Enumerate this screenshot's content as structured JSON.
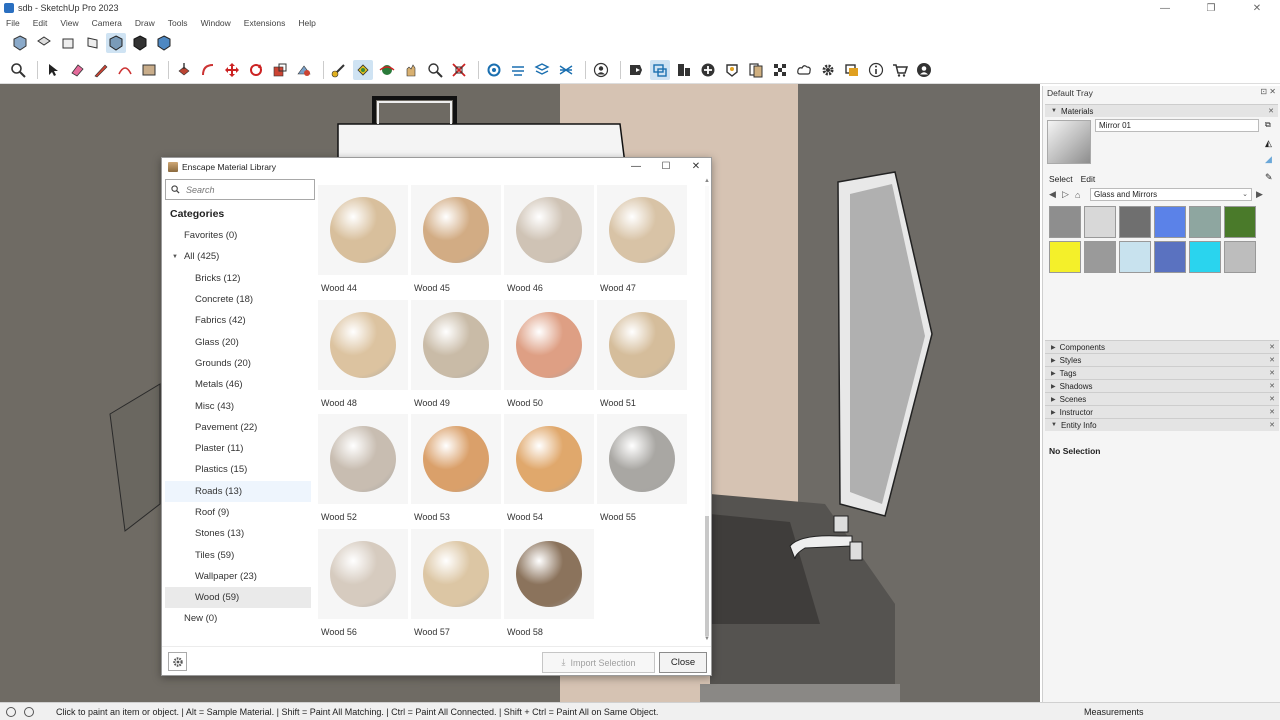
{
  "window": {
    "title": "sdb - SketchUp Pro 2023",
    "controls": [
      "—",
      "❐",
      "✕"
    ]
  },
  "menu": [
    "File",
    "Edit",
    "View",
    "Camera",
    "Draw",
    "Tools",
    "Window",
    "Extensions",
    "Help"
  ],
  "tray": {
    "title": "Default Tray",
    "materials_header": "Materials",
    "material_name": "Mirror 01",
    "select_tab": "Select",
    "edit_tab": "Edit",
    "library": "Glass and Mirrors",
    "swatch_colors": [
      "#8e8e8e",
      "#d8d8d8",
      "#6f6f6f",
      "#5b82e8",
      "#8ea6a0",
      "#4a7a2a",
      "#f4f02a",
      "#9a9a9a",
      "#c8e2ee",
      "#5a72c0",
      "#2ad4ee",
      "#bdbdbd"
    ],
    "panels": [
      "Components",
      "Styles",
      "Tags",
      "Shadows",
      "Scenes",
      "Instructor",
      "Entity Info"
    ],
    "entity_info": "No Selection"
  },
  "status": {
    "message": "Click to paint an item or object. | Alt = Sample Material. | Shift = Paint All Matching. | Ctrl = Paint All Connected. | Shift + Ctrl = Paint All on Same Object.",
    "measurements": "Measurements"
  },
  "dialog": {
    "title": "Enscape Material Library",
    "search_placeholder": "Search",
    "categories_header": "Categories",
    "categories": [
      {
        "label": "Favorites (0)",
        "level": 0
      },
      {
        "label": "All (425)",
        "level": 0,
        "expanded": true
      },
      {
        "label": "Bricks (12)",
        "level": 1
      },
      {
        "label": "Concrete (18)",
        "level": 1
      },
      {
        "label": "Fabrics (42)",
        "level": 1
      },
      {
        "label": "Glass (20)",
        "level": 1
      },
      {
        "label": "Grounds (20)",
        "level": 1
      },
      {
        "label": "Metals (46)",
        "level": 1
      },
      {
        "label": "Misc (43)",
        "level": 1
      },
      {
        "label": "Pavement (22)",
        "level": 1
      },
      {
        "label": "Plaster (11)",
        "level": 1
      },
      {
        "label": "Plastics (15)",
        "level": 1
      },
      {
        "label": "Roads (13)",
        "level": 1,
        "state": "hover"
      },
      {
        "label": "Roof (9)",
        "level": 1
      },
      {
        "label": "Stones (13)",
        "level": 1
      },
      {
        "label": "Tiles (59)",
        "level": 1
      },
      {
        "label": "Wallpaper (23)",
        "level": 1
      },
      {
        "label": "Wood (59)",
        "level": 1,
        "state": "selected"
      },
      {
        "label": "New (0)",
        "level": 0
      }
    ],
    "materials": [
      {
        "label": "Wood 44",
        "color": "#d8bf9c"
      },
      {
        "label": "Wood 45",
        "color": "#d2ac84"
      },
      {
        "label": "Wood 46",
        "color": "#cfc3b5"
      },
      {
        "label": "Wood 47",
        "color": "#d8c3a6"
      },
      {
        "label": "Wood 48",
        "color": "#dcc3a0"
      },
      {
        "label": "Wood 49",
        "color": "#c9bba7"
      },
      {
        "label": "Wood 50",
        "color": "#de9f84"
      },
      {
        "label": "Wood 51",
        "color": "#d5bd9b"
      },
      {
        "label": "Wood 52",
        "color": "#c8bdb1"
      },
      {
        "label": "Wood 53",
        "color": "#daa06a"
      },
      {
        "label": "Wood 54",
        "color": "#e0a86c"
      },
      {
        "label": "Wood 55",
        "color": "#a9a7a3"
      },
      {
        "label": "Wood 56",
        "color": "#d6cbbf"
      },
      {
        "label": "Wood 57",
        "color": "#dcc6a4"
      },
      {
        "label": "Wood 58",
        "color": "#8b735c"
      }
    ],
    "import_label": "Import Selection",
    "close_label": "Close"
  }
}
